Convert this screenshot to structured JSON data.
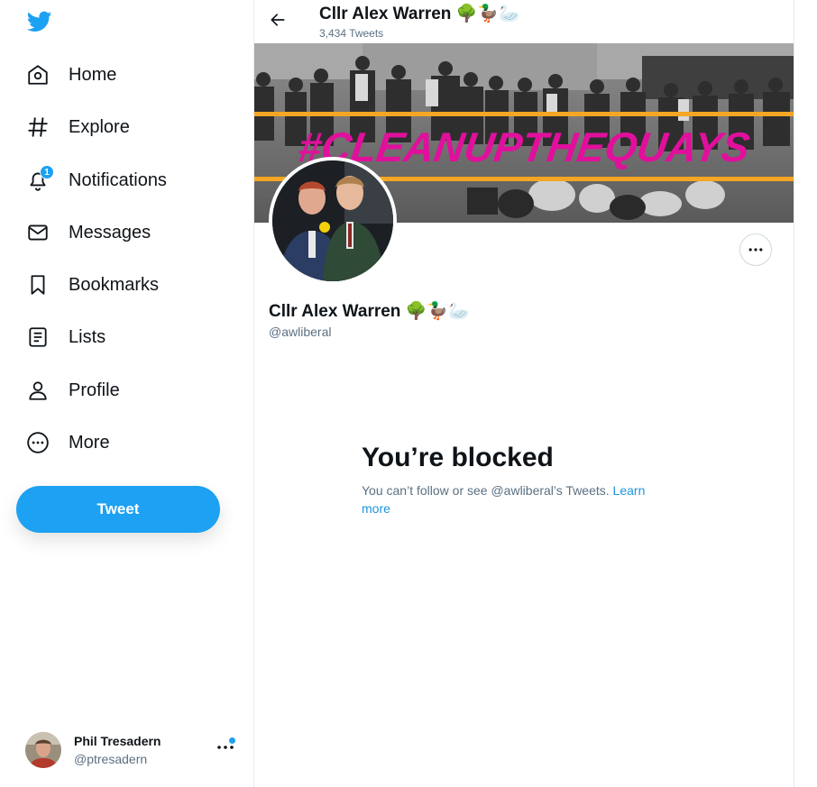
{
  "sidebar": {
    "logo_icon": "twitter-bird-icon",
    "items": [
      {
        "label": "Home",
        "icon": "home-icon"
      },
      {
        "label": "Explore",
        "icon": "hashtag-icon"
      },
      {
        "label": "Notifications",
        "icon": "bell-icon",
        "badge": "1"
      },
      {
        "label": "Messages",
        "icon": "envelope-icon"
      },
      {
        "label": "Bookmarks",
        "icon": "bookmark-icon"
      },
      {
        "label": "Lists",
        "icon": "list-icon"
      },
      {
        "label": "Profile",
        "icon": "person-icon"
      },
      {
        "label": "More",
        "icon": "more-circle-icon"
      }
    ],
    "tweet_button": "Tweet",
    "account": {
      "name": "Phil Tresadern",
      "handle": "@ptresadern"
    }
  },
  "header": {
    "title": "Cllr Alex Warren",
    "title_emoji": "🌳🦆🦢",
    "tweet_count": "3,434 Tweets"
  },
  "profile": {
    "banner_text": "#CLEANUPTHEQUAYS",
    "name": "Cllr Alex Warren",
    "name_emoji": "🌳🦆🦢",
    "handle": "@awliberal"
  },
  "blocked": {
    "title": "You’re blocked",
    "message": "You can’t follow or see @awliberal’s Tweets. ",
    "link": "Learn more"
  },
  "colors": {
    "accent": "#1da1f2",
    "banner_text": "#e0109c",
    "banner_stripe": "#f5a623",
    "secondary_text": "#5b7083"
  }
}
